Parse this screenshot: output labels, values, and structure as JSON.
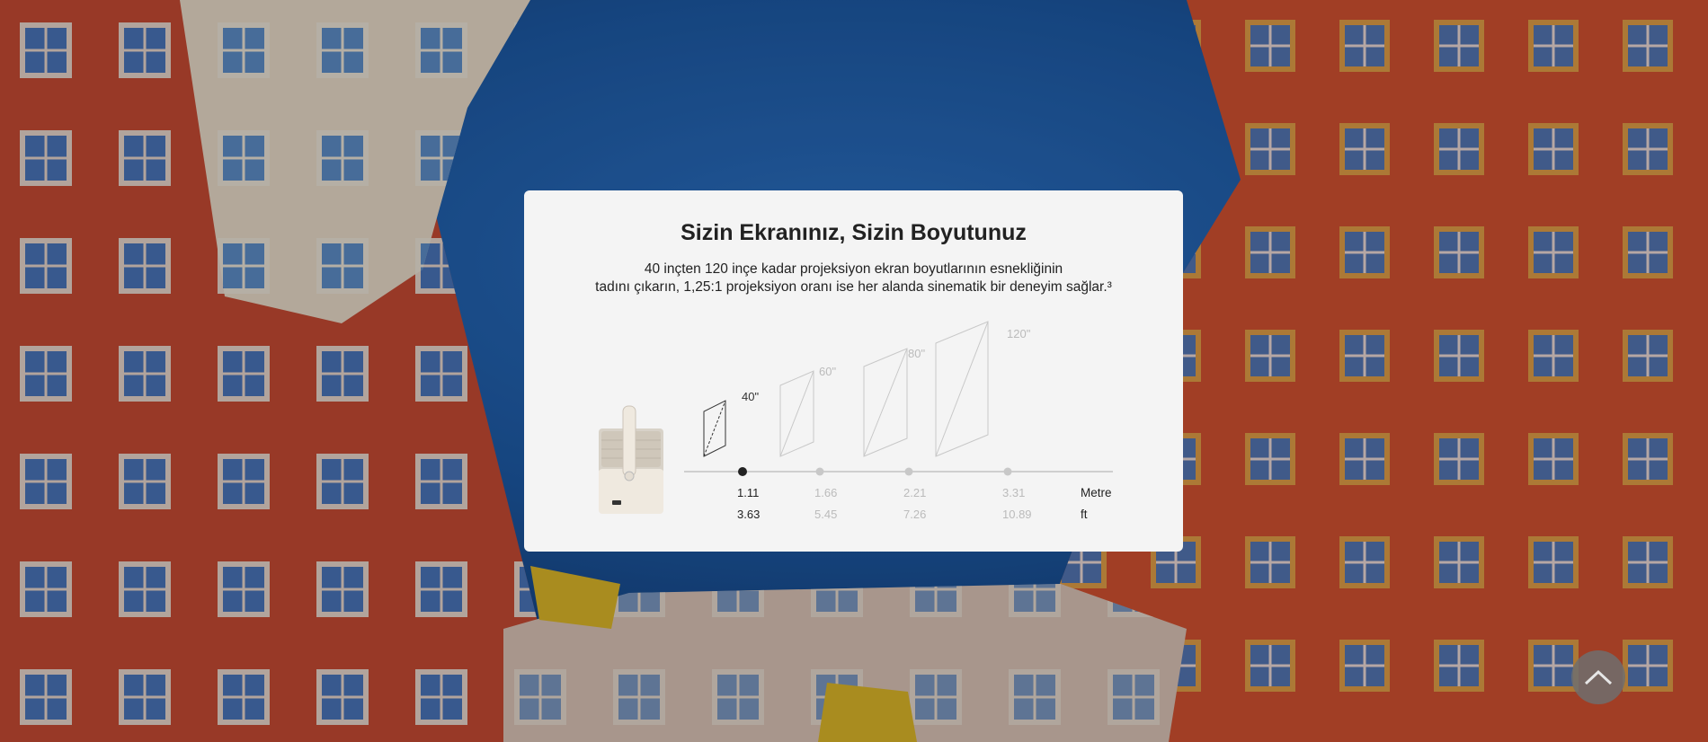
{
  "card": {
    "title": "Sizin Ekranınız, Sizin Boyutunuz",
    "description_line1": "40 inçten 120 inçe kadar projeksiyon ekran boyutlarının esnekliğinin",
    "description_line2": "tadını çıkarın, 1,25:1 projeksiyon oranı ise her alanda sinematik bir deneyim sağlar.³"
  },
  "diagram": {
    "sizes": [
      {
        "label": "40\"",
        "metre": "1.11",
        "ft": "3.63",
        "active": true
      },
      {
        "label": "60\"",
        "metre": "1.66",
        "ft": "5.45",
        "active": false
      },
      {
        "label": "80\"",
        "metre": "2.21",
        "ft": "7.26",
        "active": false
      },
      {
        "label": "120\"",
        "metre": "3.31",
        "ft": "10.89",
        "active": false
      }
    ],
    "unit_metre": "Metre",
    "unit_ft": "ft"
  },
  "colors": {
    "sky": "#1d5aa5",
    "building_red": "#c9472e",
    "card_bg": "#f4f4f4",
    "active_dot": "#222222",
    "inactive": "#bbbbbb"
  },
  "scroll_top": {
    "icon": "chevron-up-icon"
  }
}
